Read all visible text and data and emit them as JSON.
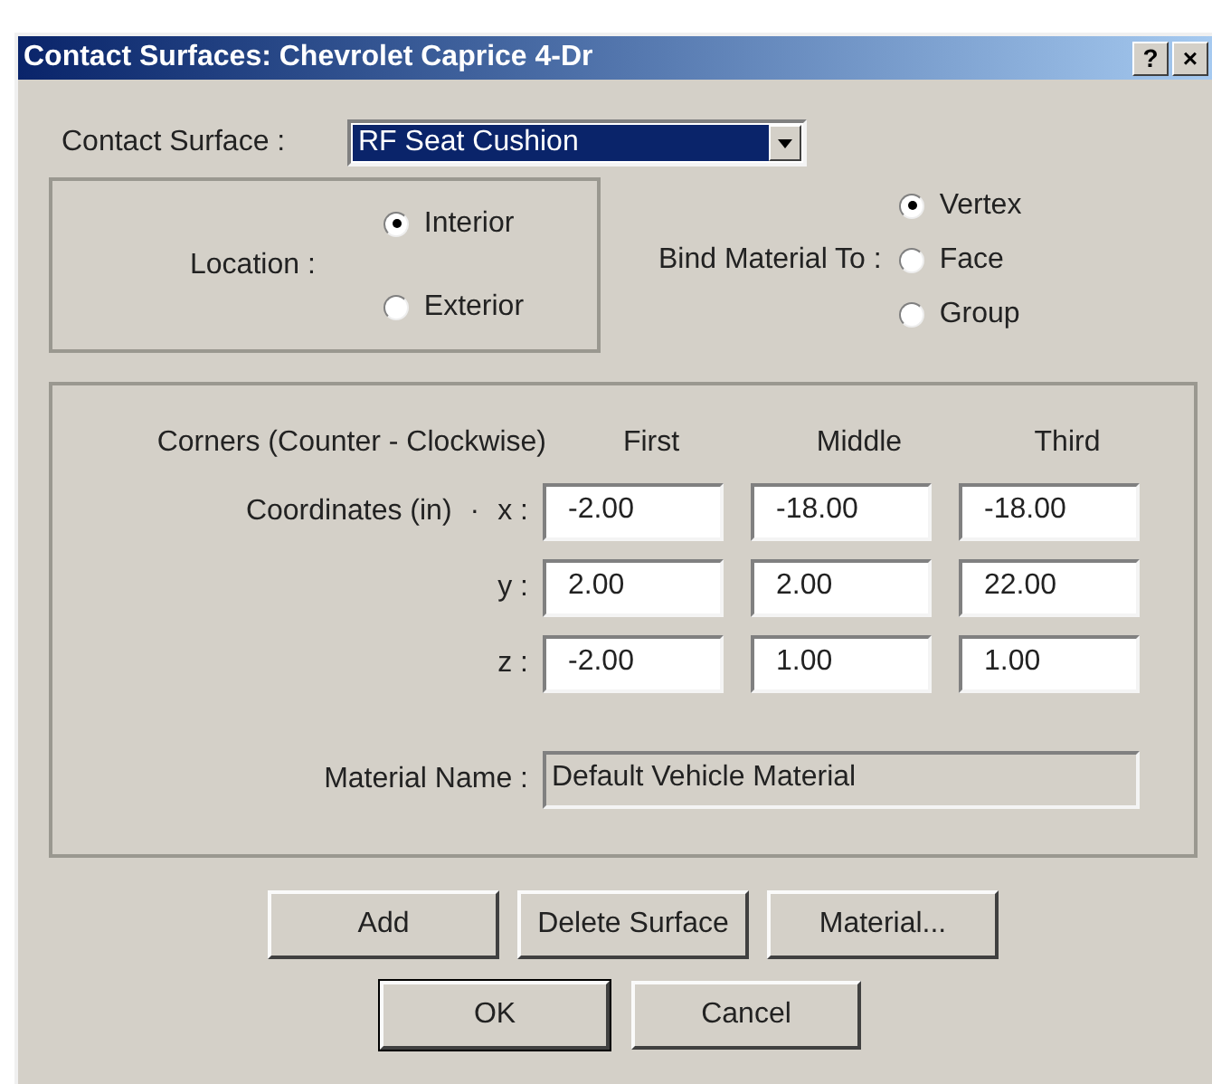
{
  "window": {
    "title": "Contact Surfaces: Chevrolet Caprice 4-Dr",
    "title_buttons": [
      "?",
      "×"
    ]
  },
  "contact_surface": {
    "label": "Contact Surface :",
    "value": "RF Seat Cushion"
  },
  "location": {
    "label": "Location :",
    "options": [
      {
        "label": "Interior",
        "selected": true
      },
      {
        "label": "Exterior",
        "selected": false
      }
    ]
  },
  "bind_material": {
    "label": "Bind Material To :",
    "options": [
      {
        "label": "Vertex",
        "selected": true
      },
      {
        "label": "Face",
        "selected": false
      },
      {
        "label": "Group",
        "selected": false
      }
    ]
  },
  "corners": {
    "label": "Corners (Counter - Clockwise)",
    "columns": [
      "First",
      "Middle",
      "Third"
    ],
    "coordinates_label": "Coordinates (in)",
    "marker": "·",
    "rows": [
      {
        "axis": "x :",
        "values": [
          "-2.00",
          "-18.00",
          "-18.00"
        ]
      },
      {
        "axis": "y :",
        "values": [
          "2.00",
          "2.00",
          "22.00"
        ]
      },
      {
        "axis": "z :",
        "values": [
          "-2.00",
          "1.00",
          "1.00"
        ]
      }
    ]
  },
  "material_name": {
    "label": "Material Name :",
    "value": "Default Vehicle Material"
  },
  "buttons": [
    {
      "label": "Add",
      "default": false
    },
    {
      "label": "Delete Surface",
      "default": false
    },
    {
      "label": "Material...",
      "default": false
    }
  ],
  "dialog_buttons": [
    {
      "label": "OK",
      "default": true
    },
    {
      "label": "Cancel",
      "default": false
    }
  ]
}
